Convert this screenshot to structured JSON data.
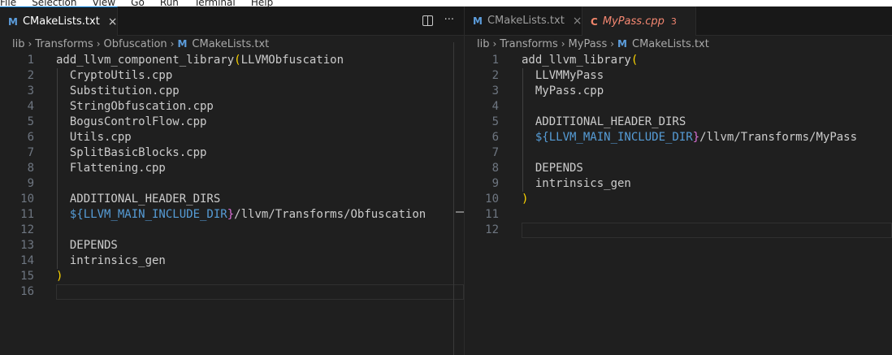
{
  "menubar": {
    "items": [
      "File",
      "Selection",
      "View",
      "Go",
      "Run",
      "Terminal",
      "Help"
    ]
  },
  "left_editor": {
    "tab": {
      "icon": "M",
      "label": "CMakeLists.txt",
      "close": "×"
    },
    "actions": {
      "more": "···"
    },
    "breadcrumb": [
      "lib",
      "Transforms",
      "Obfuscation",
      "CMakeLists.txt"
    ],
    "breadcrumb_icon": "M",
    "lines": [
      "add_llvm_component_library",
      "(",
      "LLVMObfuscation",
      "CryptoUtils.cpp",
      "Substitution.cpp",
      "StringObfuscation.cpp",
      "BogusControlFlow.cpp",
      "Utils.cpp",
      "SplitBasicBlocks.cpp",
      "Flattening.cpp",
      "ADDITIONAL_HEADER_DIRS",
      "${",
      "LLVM_MAIN_INCLUDE_DIR",
      "}",
      "/llvm/Transforms/Obfuscation",
      "DEPENDS",
      "intrinsics_gen",
      ")"
    ],
    "line_numbers": [
      "1",
      "2",
      "3",
      "4",
      "5",
      "6",
      "7",
      "8",
      "9",
      "10",
      "11",
      "12",
      "13",
      "14",
      "15",
      "16"
    ]
  },
  "right_editor": {
    "tabs": [
      {
        "icon": "M",
        "label": "CMakeLists.txt",
        "close": "×"
      },
      {
        "icon": "C",
        "label": "MyPass.cpp",
        "problems": "3"
      }
    ],
    "breadcrumb": [
      "lib",
      "Transforms",
      "MyPass",
      "CMakeLists.txt"
    ],
    "breadcrumb_icon": "M",
    "lines": [
      "add_llvm_library",
      "(",
      "LLVMMyPass",
      "MyPass.cpp",
      "ADDITIONAL_HEADER_DIRS",
      "${",
      "LLVM_MAIN_INCLUDE_DIR",
      "}",
      "/llvm/Transforms/MyPass",
      "DEPENDS",
      "intrinsics_gen",
      ")"
    ],
    "line_numbers": [
      "1",
      "2",
      "3",
      "4",
      "5",
      "6",
      "7",
      "8",
      "9",
      "10",
      "11",
      "12"
    ]
  },
  "colors": {
    "accent": "#0078d4",
    "variable": "#569cd6",
    "paren": "#ffd700",
    "brace": "#da70d6",
    "error": "#f48771"
  }
}
